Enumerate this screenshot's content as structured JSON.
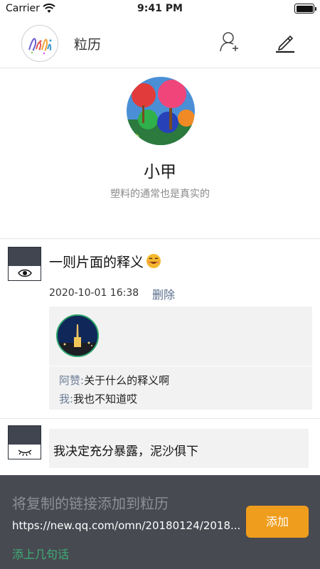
{
  "status_bar": {
    "carrier": "Carrier",
    "time": "9:41 PM"
  },
  "navbar": {
    "app_name": "粒历"
  },
  "profile": {
    "name": "小甲",
    "signature": "塑料的通常也是真实的"
  },
  "posts": [
    {
      "text": "一则片面的释义",
      "time": "2020-10-01 16:38",
      "delete_label": "删除",
      "comments": [
        {
          "author": "阿赞",
          "separator": ":",
          "text": "关于什么的释义啊"
        },
        {
          "author": "我",
          "separator": ":",
          "text": "我也不知道哎"
        }
      ]
    },
    {
      "text": "我决定充分暴露，泥沙俱下"
    }
  ],
  "share_sheet": {
    "title": "将复制的链接添加到粒历",
    "url": "https://new.qq.com/omn/20180124/2018...",
    "note": "添上几句话",
    "add_label": "添加"
  },
  "colors": {
    "accent": "#ef9d1c",
    "sheet_bg": "#474a51",
    "link": "#5a6f8e",
    "note": "#3fae76"
  },
  "icons": [
    "wifi-icon",
    "battery-icon",
    "add-friend-icon",
    "compose-icon",
    "eye-icon",
    "closed-eye-icon",
    "smile-emoji-icon"
  ]
}
